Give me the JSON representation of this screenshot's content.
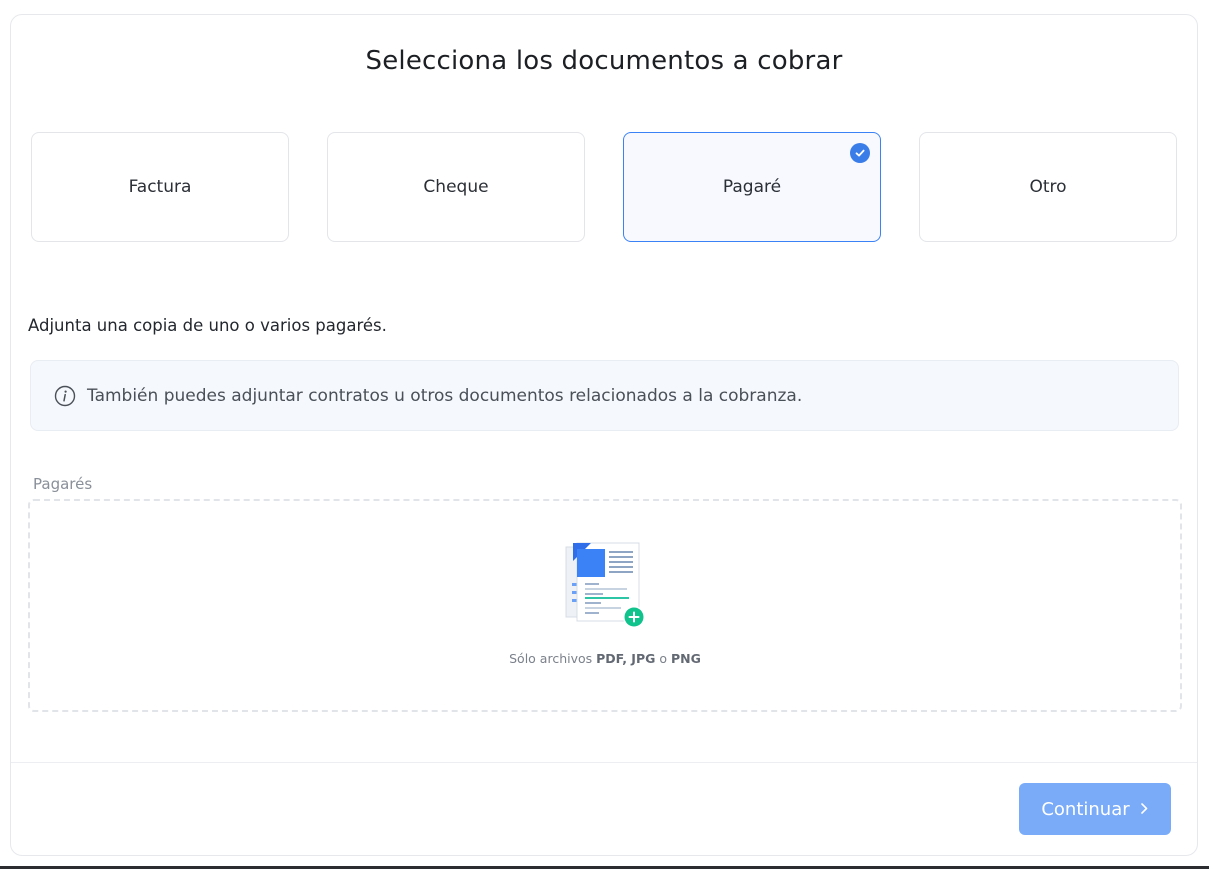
{
  "header": {
    "title": "Selecciona los documentos a cobrar"
  },
  "document_types": [
    {
      "label": "Factura",
      "selected": false
    },
    {
      "label": "Cheque",
      "selected": false
    },
    {
      "label": "Pagaré",
      "selected": true
    },
    {
      "label": "Otro",
      "selected": false
    }
  ],
  "instruction": "Adjunta una copia de uno o varios pagarés.",
  "info_box": {
    "icon": "info-icon",
    "text": "También puedes adjuntar contratos u otros documentos relacionados a la cobranza."
  },
  "upload": {
    "label": "Pagarés",
    "hint_prefix": "Sólo archivos ",
    "formats_a": "PDF, JPG",
    "hint_mid": " o ",
    "formats_b": "PNG"
  },
  "footer": {
    "continue_label": "Continuar",
    "continue_icon": "chevron-right-icon"
  },
  "colors": {
    "accent": "#3b82f6",
    "button": "#7aabf9",
    "success": "#10c28c"
  }
}
